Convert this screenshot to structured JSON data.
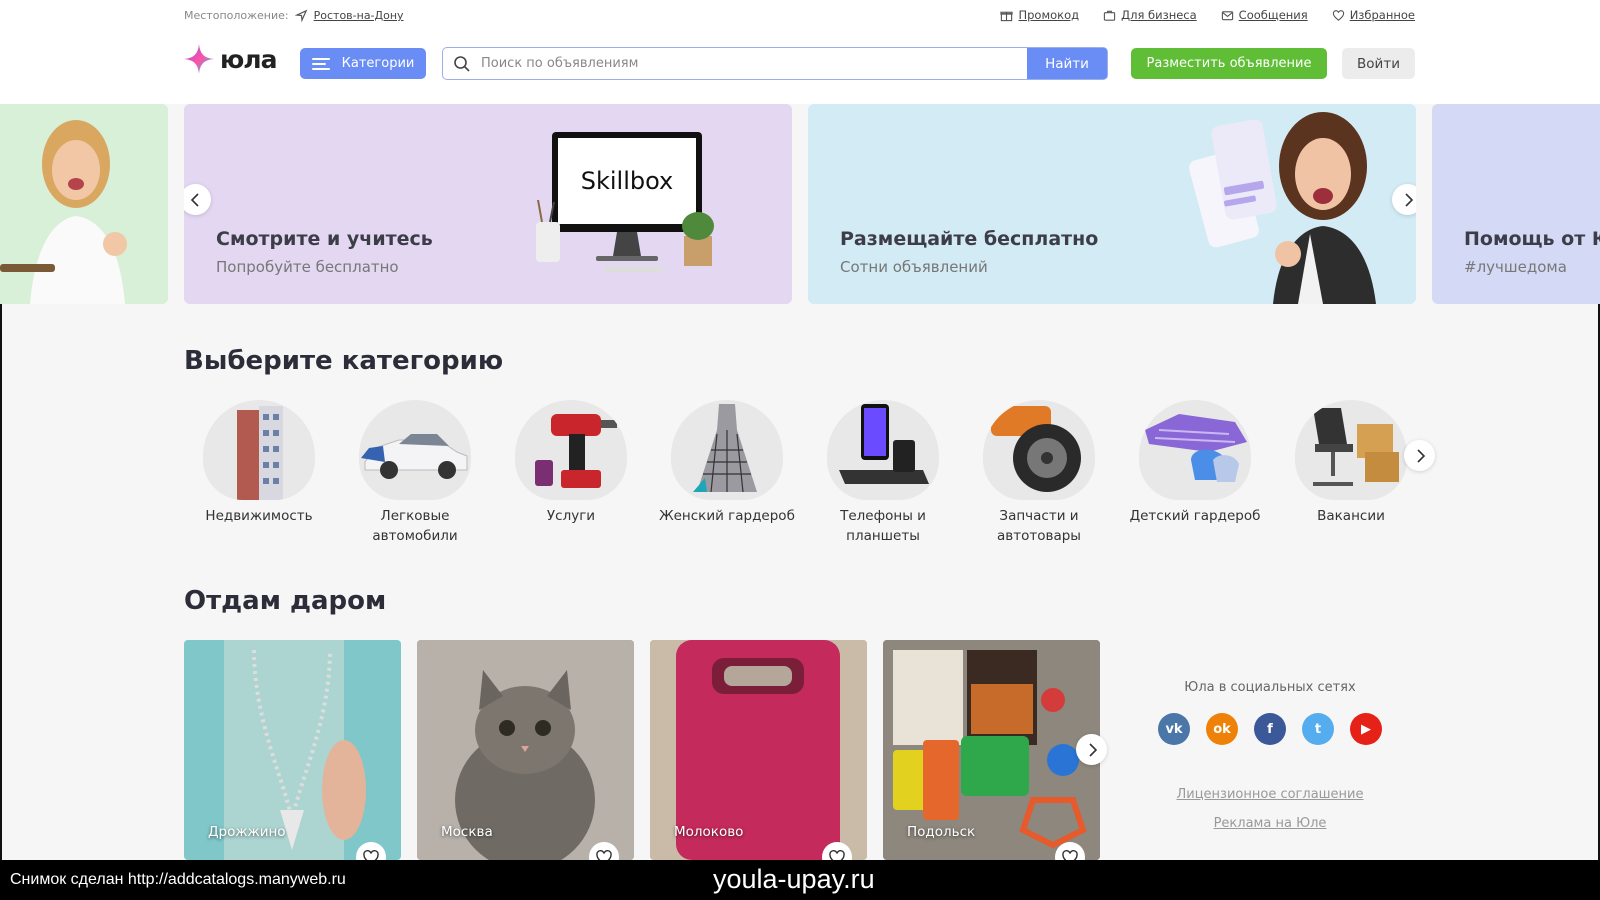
{
  "topbar": {
    "location_label": "Местоположение:",
    "city": "Ростов-на-Дону",
    "links": [
      {
        "label": "Промокод",
        "icon": "gift-icon"
      },
      {
        "label": "Для бизнеса",
        "icon": "briefcase-icon"
      },
      {
        "label": "Сообщения",
        "icon": "mail-icon"
      },
      {
        "label": "Избранное",
        "icon": "heart-icon"
      }
    ]
  },
  "header": {
    "logo_text": "юла",
    "categories_button": "Категории",
    "search_placeholder": "Поиск по объявлениям",
    "search_value": "",
    "search_button": "Найти",
    "post_button": "Разместить объявление",
    "login_button": "Войти"
  },
  "banners": [
    {
      "title": "Смотрите и учитесь",
      "subtitle": "Попробуйте бесплатно",
      "brand": "Skillbox"
    },
    {
      "title": "Размещайте бесплатно",
      "subtitle": "Сотни объявлений"
    },
    {
      "title": "Помощь от Юл",
      "subtitle": "#лучшедома"
    }
  ],
  "categories": {
    "title": "Выберите категорию",
    "items": [
      {
        "label": "Недвижимость",
        "icon": "building-icon"
      },
      {
        "label": "Легковые автомобили",
        "icon": "car-icon"
      },
      {
        "label": "Услуги",
        "icon": "drill-icon"
      },
      {
        "label": "Женский гардероб",
        "icon": "dress-icon"
      },
      {
        "label": "Телефоны и планшеты",
        "icon": "phone-icon"
      },
      {
        "label": "Запчасти и автотовары",
        "icon": "wheel-icon"
      },
      {
        "label": "Детский гардероб",
        "icon": "kids-clothes-icon"
      },
      {
        "label": "Вакансии",
        "icon": "office-chair-icon"
      }
    ]
  },
  "giveaway": {
    "title": "Отдам даром",
    "items": [
      {
        "place": "Дрожжино",
        "bg": "#7fc7c9"
      },
      {
        "place": "Москва",
        "bg": "#9a9590"
      },
      {
        "place": "Молоково",
        "bg": "#b9a893"
      },
      {
        "place": "Подольск",
        "bg": "#8a8378"
      }
    ]
  },
  "social": {
    "title": "Юла в социальных сетях",
    "networks": [
      {
        "name": "vk",
        "glyph": "vk",
        "color": "#4a76a8"
      },
      {
        "name": "odnoklassniki",
        "glyph": "ok",
        "color": "#ee8208"
      },
      {
        "name": "facebook",
        "glyph": "f",
        "color": "#3b5998"
      },
      {
        "name": "twitter",
        "glyph": "t",
        "color": "#55acee"
      },
      {
        "name": "youtube",
        "glyph": "▶",
        "color": "#e62117"
      }
    ],
    "license": "Лицензионное соглашение",
    "ads": "Реклама на Юле"
  },
  "watermark": {
    "left": "Снимок сделан http://addcatalogs.manyweb.ru",
    "center": "youla-upay.ru"
  }
}
